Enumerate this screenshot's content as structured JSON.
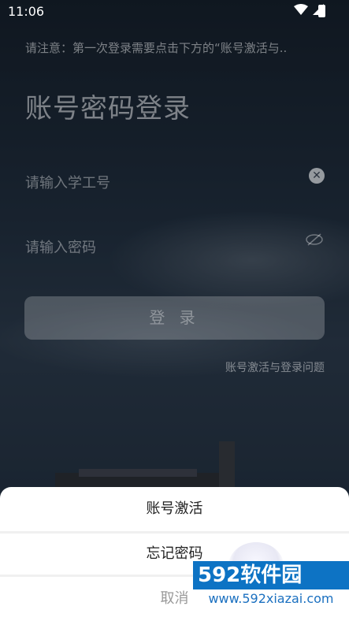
{
  "status_bar": {
    "time": "11:06"
  },
  "login": {
    "notice": "请注意：第一次登录需要点击下方的“账号激活与..",
    "title": "账号密码登录",
    "account_placeholder": "请输入学工号",
    "password_placeholder": "请输入密码",
    "login_label": "登 录",
    "help_link": "账号激活与登录问题"
  },
  "sheet": {
    "items": [
      "账号激活",
      "忘记密码"
    ],
    "cancel": "取消"
  },
  "watermark": {
    "brand": "592软件园",
    "url": "www.592xiazai.com"
  },
  "icons": {
    "clear": "clear-circle-icon",
    "password_toggle": "eye-off-icon",
    "wifi": "wifi-icon",
    "signal": "signal-icon",
    "battery": "battery-charging-icon"
  }
}
